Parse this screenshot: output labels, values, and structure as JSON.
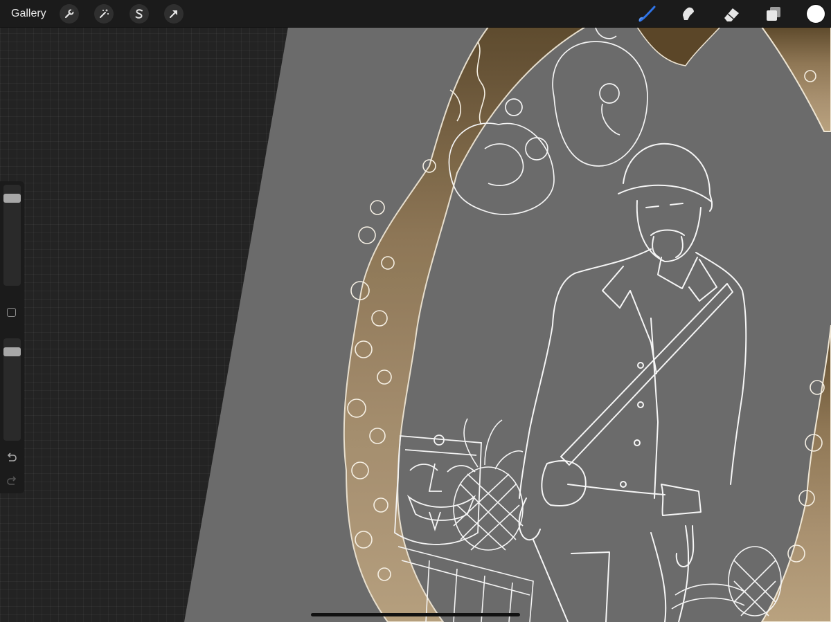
{
  "topbar": {
    "gallery_label": "Gallery",
    "left_tools": [
      {
        "name": "actions",
        "icon": "wrench-icon"
      },
      {
        "name": "adjustments",
        "icon": "magic-wand-icon"
      },
      {
        "name": "selection",
        "icon": "selection-s-icon"
      },
      {
        "name": "transform",
        "icon": "arrow-cursor-icon"
      }
    ],
    "right_tools": [
      {
        "name": "brush",
        "icon": "brush-icon",
        "active": true
      },
      {
        "name": "smudge",
        "icon": "smudge-finger-icon",
        "active": false
      },
      {
        "name": "eraser",
        "icon": "eraser-icon",
        "active": false
      },
      {
        "name": "layers",
        "icon": "layers-icon",
        "active": false
      }
    ],
    "current_color": "#ffffff",
    "active_tool_color": "#2f74e8"
  },
  "sidebar": {
    "brush_size": 0.9,
    "brush_opacity": 0.9,
    "modify_icon": "square-icon",
    "undo_icon": "undo-icon",
    "redo_icon": "redo-icon"
  },
  "colors": {
    "canvas_grey": "#6b6b6b",
    "line_white": "#f4f4f4",
    "frame_gold": "#a48a63",
    "background_dark": "#232323"
  }
}
